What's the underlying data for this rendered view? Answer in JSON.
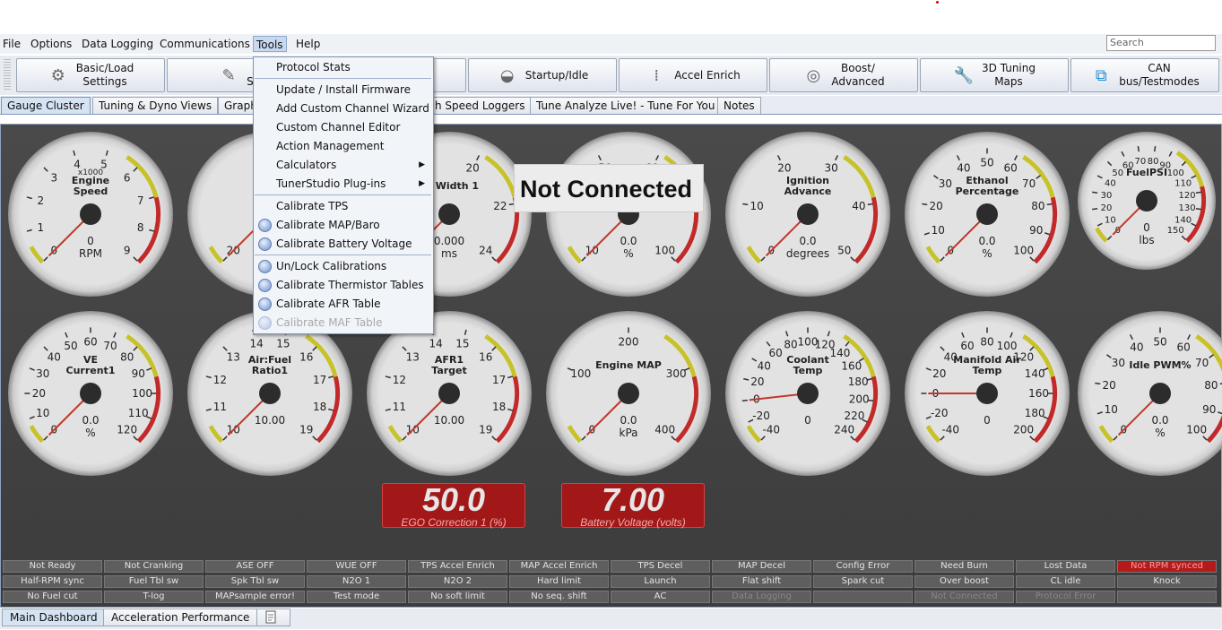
{
  "menubar": {
    "items": [
      "File",
      "Options",
      "Data Logging",
      "Communications",
      "Tools",
      "Help"
    ],
    "active": "Tools",
    "search_placeholder": "Search"
  },
  "toolbar": [
    {
      "label": "Basic/Load\nSettings",
      "icon": "gear-icon"
    },
    {
      "label": "F\nSet",
      "icon": "injector-icon"
    },
    {
      "label": "",
      "icon": ""
    },
    {
      "label": "Startup/Idle",
      "icon": "startup-icon"
    },
    {
      "label": "Accel Enrich",
      "icon": "accel-icon"
    },
    {
      "label": "Boost/\nAdvanced",
      "icon": "turbo-icon"
    },
    {
      "label": "3D Tuning\nMaps",
      "icon": "wrench-icon"
    },
    {
      "label": "CAN\nbus/Testmodes",
      "icon": "network-icon"
    }
  ],
  "tabs": [
    "Gauge Cluster",
    "Tuning & Dyno Views",
    "Graph",
    "h Speed Loggers",
    "Tune Analyze Live! - Tune For You",
    "Notes"
  ],
  "tools_menu": [
    {
      "label": "Protocol Stats",
      "icon": false
    },
    {
      "sep": true
    },
    {
      "label": "Update / Install Firmware",
      "icon": false
    },
    {
      "label": "Add Custom Channel Wizard",
      "icon": false
    },
    {
      "label": "Custom Channel Editor",
      "icon": false
    },
    {
      "label": "Action Management",
      "icon": false
    },
    {
      "label": "Calculators",
      "icon": false,
      "submenu": true
    },
    {
      "label": "TunerStudio Plug-ins",
      "icon": false,
      "submenu": true
    },
    {
      "sep": true
    },
    {
      "label": "Calibrate TPS",
      "icon": false
    },
    {
      "label": "Calibrate MAP/Baro",
      "icon": true
    },
    {
      "label": "Calibrate Battery Voltage",
      "icon": true
    },
    {
      "sep": true
    },
    {
      "label": "Un/Lock Calibrations",
      "icon": true
    },
    {
      "label": "Calibrate Thermistor Tables",
      "icon": true
    },
    {
      "label": "Calibrate AFR Table",
      "icon": true
    },
    {
      "label": "Calibrate MAF Table",
      "icon": true,
      "disabled": true
    }
  ],
  "not_connected": "Not Connected",
  "gauges": [
    {
      "title": "Engine Speed",
      "sub": "x1000",
      "value": "0",
      "unit": "RPM",
      "ticks": [
        "0",
        "1",
        "2",
        "3",
        "4",
        "5",
        "6",
        "7",
        "8",
        "9"
      ],
      "min": 0,
      "max": 9,
      "needle": 0
    },
    {
      "title": "",
      "sub": "",
      "value": "",
      "unit": "",
      "ticks": [
        "20",
        "30",
        "40"
      ],
      "min": 0,
      "max": 100,
      "needle": 0
    },
    {
      "title": "se Width 1",
      "sub": "",
      "value": "0.000",
      "unit": "ms",
      "ticks": [
        "12",
        "14",
        "16",
        "20",
        "22",
        "24"
      ],
      "min": 0,
      "max": 24,
      "needle": 0
    },
    {
      "title": "",
      "sub": "",
      "value": "0.0",
      "unit": "%",
      "ticks": [
        "10",
        "20",
        "50",
        "60",
        "90",
        "100"
      ],
      "min": 0,
      "max": 100,
      "needle": 0
    },
    {
      "title": "Ignition Advance",
      "sub": "",
      "value": "0.0",
      "unit": "degrees",
      "ticks": [
        "0",
        "10",
        "20",
        "30",
        "40",
        "50"
      ],
      "min": 0,
      "max": 50,
      "needle": 0
    },
    {
      "title": "Ethanol Percentage",
      "sub": "",
      "value": "0.0",
      "unit": "%",
      "ticks": [
        "0",
        "10",
        "20",
        "30",
        "40",
        "50",
        "60",
        "70",
        "80",
        "90",
        "100"
      ],
      "min": 0,
      "max": 100,
      "needle": 0
    },
    {
      "title": "FuelPSI",
      "sub": "",
      "value": "0",
      "unit": "lbs",
      "ticks": [
        "0",
        "10",
        "20",
        "30",
        "40",
        "50",
        "60",
        "70",
        "80",
        "90",
        "100",
        "110",
        "120",
        "130",
        "140",
        "150"
      ],
      "min": 0,
      "max": 150,
      "needle": 0
    },
    {
      "title": "VE Current1",
      "sub": "",
      "value": "0.0",
      "unit": "%",
      "ticks": [
        "0",
        "10",
        "20",
        "30",
        "40",
        "50",
        "60",
        "70",
        "80",
        "90",
        "100",
        "110",
        "120"
      ],
      "min": 0,
      "max": 120,
      "needle": 0
    },
    {
      "title": "Air:Fuel Ratio1",
      "sub": "",
      "value": "10.00",
      "unit": "",
      "ticks": [
        "10",
        "11",
        "12",
        "13",
        "14",
        "15",
        "16",
        "17",
        "18",
        "19"
      ],
      "min": 10,
      "max": 19,
      "needle": 10
    },
    {
      "title": "AFR1 Target",
      "sub": "",
      "value": "10.00",
      "unit": "",
      "ticks": [
        "10",
        "11",
        "12",
        "13",
        "14",
        "15",
        "16",
        "17",
        "18",
        "19"
      ],
      "min": 10,
      "max": 19,
      "needle": 10
    },
    {
      "title": "Engine MAP",
      "sub": "",
      "value": "0.0",
      "unit": "kPa",
      "ticks": [
        "0",
        "100",
        "200",
        "300",
        "400"
      ],
      "min": 0,
      "max": 400,
      "needle": 0
    },
    {
      "title": "Coolant Temp",
      "sub": "",
      "value": "0",
      "unit": "",
      "ticks": [
        "-40",
        "-20",
        "0",
        "20",
        "40",
        "60",
        "80",
        "100",
        "120",
        "140",
        "160",
        "180",
        "200",
        "220",
        "240"
      ],
      "min": -40,
      "max": 240,
      "needle": 0
    },
    {
      "title": "Manifold Air Temp",
      "sub": "",
      "value": "0",
      "unit": "",
      "ticks": [
        "-40",
        "-20",
        "0",
        "20",
        "40",
        "60",
        "80",
        "100",
        "120",
        "140",
        "160",
        "180",
        "200"
      ],
      "min": -40,
      "max": 200,
      "needle": 0
    },
    {
      "title": "Idle PWM%",
      "sub": "",
      "value": "0.0",
      "unit": "%",
      "ticks": [
        "0",
        "10",
        "20",
        "30",
        "40",
        "50",
        "60",
        "70",
        "80",
        "90",
        "100"
      ],
      "min": 0,
      "max": 100,
      "needle": 0
    }
  ],
  "digitals": [
    {
      "value": "50.0",
      "label": "EGO Correction 1 (%)"
    },
    {
      "value": "7.00",
      "label": "Battery Voltage (volts)"
    }
  ],
  "indicators": [
    [
      "Not Ready",
      "Not Cranking",
      "ASE OFF",
      "WUE OFF",
      "TPS Accel Enrich",
      "MAP Accel Enrich",
      "TPS Decel",
      "MAP Decel",
      "Config Error",
      "Need Burn",
      "Lost Data",
      "Not RPM synced"
    ],
    [
      "Half-RPM sync",
      "Fuel Tbl sw",
      "Spk Tbl sw",
      "N2O 1",
      "N2O 2",
      "Hard limit",
      "Launch",
      "Flat shift",
      "Spark cut",
      "Over boost",
      "CL idle",
      "Knock"
    ],
    [
      "No Fuel cut",
      "T-log",
      "MAPsample error!",
      "Test mode",
      "No soft limit",
      "No seq. shift",
      "AC",
      "Data Logging",
      "",
      "Not Connected",
      "Protocol Error",
      ""
    ]
  ],
  "bottom_tabs": [
    "Main Dashboard",
    "Acceleration Performance"
  ],
  "colors": {
    "accent_red": "#a21818",
    "indicator_red": "#b41a1a",
    "menu_highlight": "#c8d8ee"
  }
}
